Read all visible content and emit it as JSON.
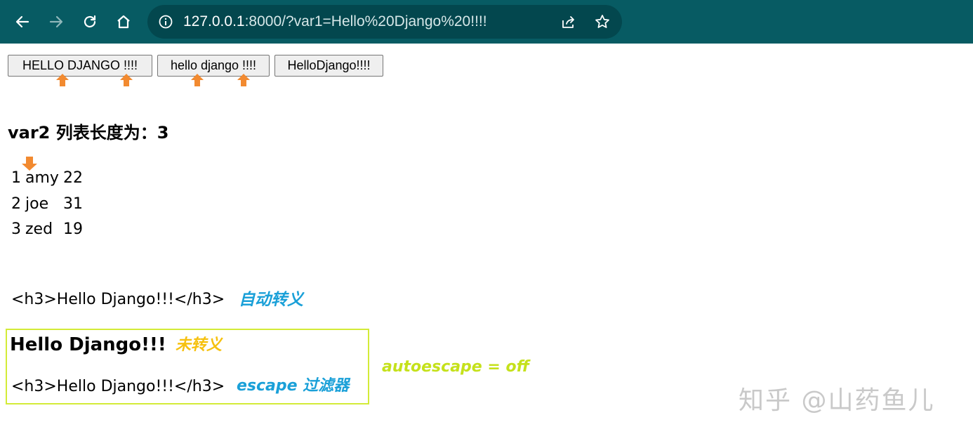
{
  "browser": {
    "url_host": "127.0.0.1",
    "url_rest": ":8000/?var1=Hello%20Django%20!!!!",
    "icons": [
      "back-icon",
      "forward-icon",
      "reload-icon",
      "home-icon",
      "info-icon",
      "share-icon",
      "star-icon"
    ]
  },
  "buttons": {
    "upper": "HELLO DJANGO !!!!",
    "lower": "hello django !!!!",
    "no_space": "HelloDjango!!!!"
  },
  "heading": "var2 列表长度为：3",
  "list": [
    {
      "index": "1",
      "name": "amy",
      "age": "22"
    },
    {
      "index": "2",
      "name": "joe",
      "age": "31"
    },
    {
      "index": "3",
      "name": "zed",
      "age": "19"
    }
  ],
  "escape_demo": {
    "auto_text": "<h3>Hello Django!!!</h3>",
    "auto_note": "自动转义",
    "rendered_text": "Hello Django!!!",
    "rendered_note": "未转义",
    "filter_text": "<h3>Hello Django!!!</h3>",
    "filter_note": "escape 过滤器",
    "autoescape_note": "autoescape = off"
  },
  "watermark": "知乎 @山药鱼儿",
  "colors": {
    "toolbar": "#075b63",
    "omnibox": "#03474e",
    "arrow": "#f28a30",
    "note_blue": "#1aa0d8",
    "note_yellow": "#f6c10f",
    "note_lime": "#c5e11b",
    "box_border": "#d3eb38"
  }
}
